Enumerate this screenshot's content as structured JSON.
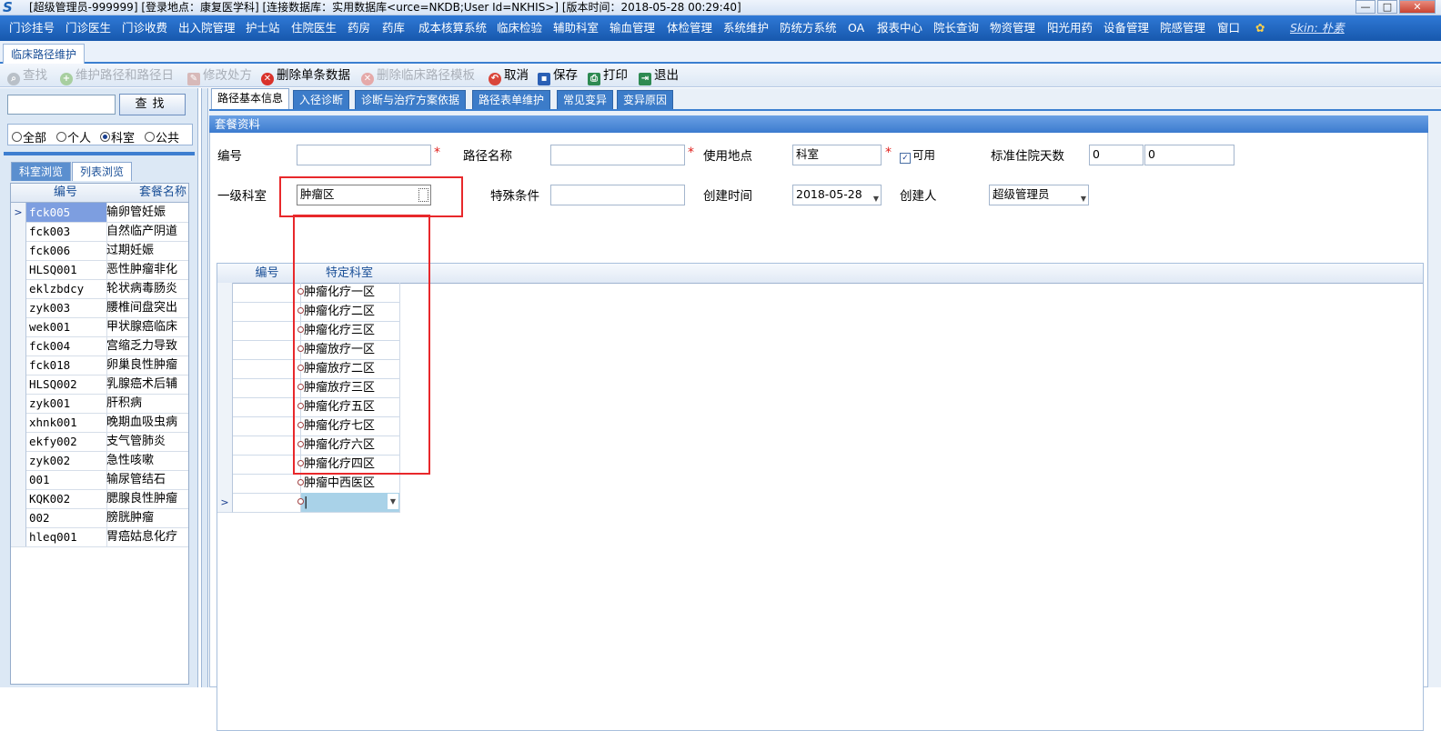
{
  "window": {
    "title": "[超级管理员-999999] [登录地点：康复医学科] [连接数据库：实用数据库<urce=NKDB;User Id=NKHIS>] [版本时间：2018-05-28 00:29:40]",
    "min_label": "—",
    "max_label": "□",
    "close_label": "✕"
  },
  "menu": {
    "items": [
      "门诊挂号",
      "门诊医生",
      "门诊收费",
      "出入院管理",
      "护士站",
      "住院医生",
      "药房",
      "药库",
      "成本核算系统",
      "临床检验",
      "辅助科室",
      "输血管理",
      "体检管理",
      "系统维护",
      "防统方系统",
      "OA",
      "报表中心",
      "院长查询",
      "物资管理",
      "阳光用药",
      "设备管理",
      "院感管理",
      "窗口"
    ],
    "skin_label": "Skin: 朴素"
  },
  "module_tab": "临床路径维护",
  "toolbar": {
    "find": "查找",
    "maintain_path": "维护路径和路径日",
    "modify_prescription": "修改处方",
    "delete_single": "删除单条数据",
    "delete_template": "删除临床路径模板",
    "cancel": "取消",
    "save": "保存",
    "print": "打印",
    "exit": "退出"
  },
  "left": {
    "search_value": "",
    "search_button": "查找",
    "scope_options": [
      "全部",
      "个人",
      "科室",
      "公共"
    ],
    "scope_selected": "科室",
    "tabs": [
      "科室浏览",
      "列表浏览"
    ],
    "grid_headers": [
      "编号",
      "套餐名称"
    ],
    "rows": [
      {
        "code": "fck005",
        "name": "输卵管妊娠",
        "selected": true
      },
      {
        "code": "fck003",
        "name": "自然临产阴道"
      },
      {
        "code": "fck006",
        "name": "过期妊娠"
      },
      {
        "code": "HLSQ001",
        "name": "恶性肿瘤非化"
      },
      {
        "code": "eklzbdcy",
        "name": "轮状病毒肠炎"
      },
      {
        "code": "zyk003",
        "name": "腰椎间盘突出"
      },
      {
        "code": "wek001",
        "name": "甲状腺癌临床"
      },
      {
        "code": "fck004",
        "name": "宫缩乏力导致"
      },
      {
        "code": "fck018",
        "name": "卵巢良性肿瘤"
      },
      {
        "code": "HLSQ002",
        "name": "乳腺癌术后辅"
      },
      {
        "code": "zyk001",
        "name": "肝积病"
      },
      {
        "code": "xhnk001",
        "name": "晚期血吸虫病"
      },
      {
        "code": "ekfy002",
        "name": "支气管肺炎"
      },
      {
        "code": "zyk002",
        "name": "急性咳嗽"
      },
      {
        "code": "001",
        "name": "输尿管结石"
      },
      {
        "code": "KQK002",
        "name": "腮腺良性肿瘤"
      },
      {
        "code": "002",
        "name": "膀胱肿瘤"
      },
      {
        "code": "hleq001",
        "name": "胃癌姑息化疗"
      }
    ]
  },
  "main_tabs": [
    "路径基本信息",
    "入径诊断",
    "诊断与治疗方案依据",
    "路径表单维护",
    "常见变异",
    "变异原因"
  ],
  "section_title": "套餐资料",
  "form": {
    "code_label": "编号",
    "code_value": "",
    "path_name_label": "路径名称",
    "path_name_value": "",
    "location_label": "使用地点",
    "location_value": "科室",
    "enabled_label": "可用",
    "std_days_label": "标准住院天数",
    "std_days_min": "0",
    "std_days_max": "0",
    "dept_label": "一级科室",
    "dept_value": "肿瘤区",
    "special_label": "特殊条件",
    "special_value": "",
    "created_time_label": "创建时间",
    "created_time_value": "2018-05-28",
    "creator_label": "创建人",
    "creator_value": "超级管理员",
    "required_mark": "*"
  },
  "dept_grid": {
    "headers": [
      "编号",
      "特定科室"
    ],
    "rows": [
      "肿瘤化疗一区",
      "肿瘤化疗二区",
      "肿瘤化疗三区",
      "肿瘤放疗一区",
      "肿瘤放疗二区",
      "肿瘤放疗三区",
      "肿瘤化疗五区",
      "肿瘤化疗七区",
      "肿瘤化疗六区",
      "肿瘤化疗四区",
      "肿瘤中西医区"
    ],
    "edit_row_value": "|"
  },
  "colors": {
    "menu_bg": "#1f66c0",
    "highlight_box": "#e8282b",
    "selected_row": "#7d9ee0",
    "editing_cell": "#a9d2e8"
  }
}
